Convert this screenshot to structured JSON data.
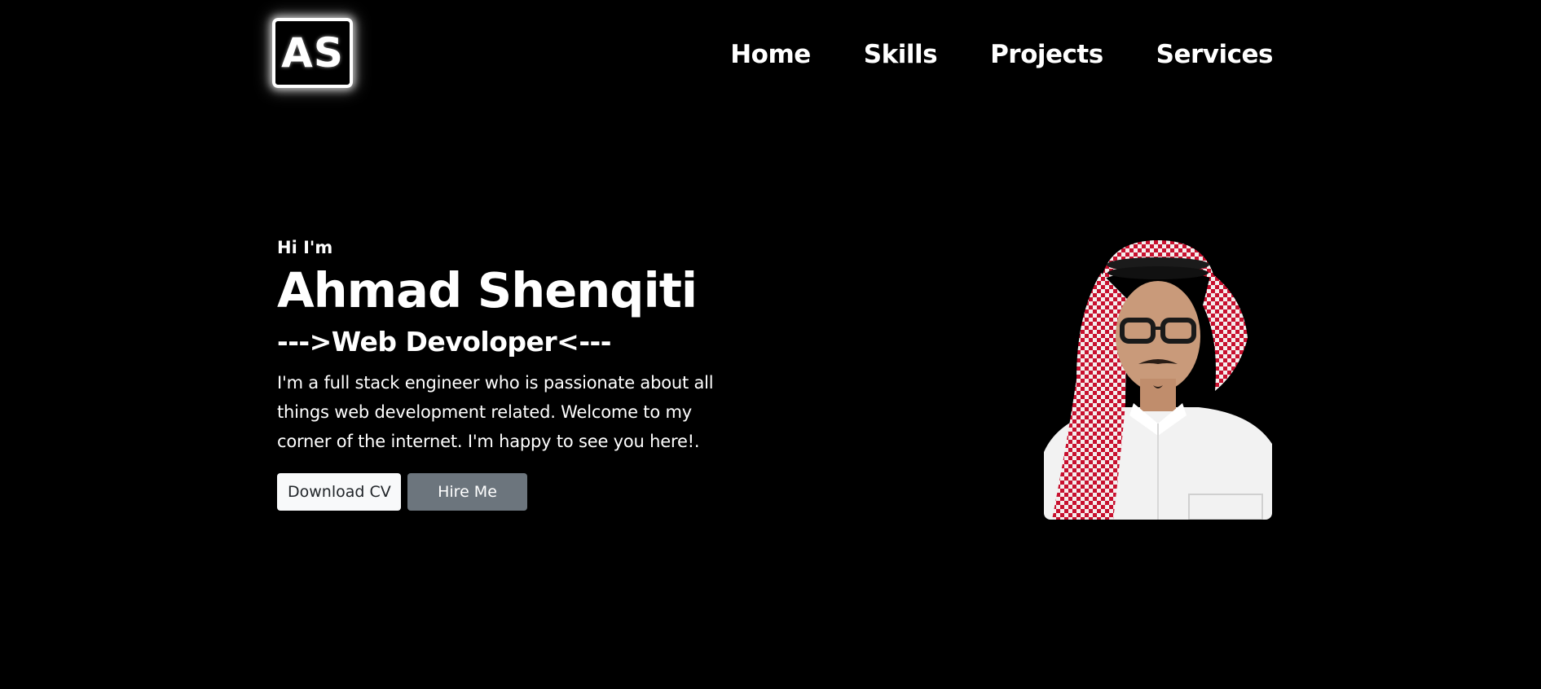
{
  "header": {
    "logo_text": "AS",
    "nav": [
      {
        "label": "Home"
      },
      {
        "label": "Skills"
      },
      {
        "label": "Projects"
      },
      {
        "label": "Services"
      }
    ]
  },
  "hero": {
    "greeting": "Hi I'm",
    "name": "Ahmad Shenqiti",
    "role": "--->Web Devoloper<---",
    "description": "I'm a full stack engineer who is passionate about all things web development related. Welcome to my corner of the internet. I'm happy to see you here!.",
    "buttons": {
      "download_cv": "Download CV",
      "hire_me": "Hire Me"
    }
  },
  "colors": {
    "background": "#000000",
    "text": "#ffffff",
    "button_light": "#f8f9fa",
    "button_secondary": "#6c757d",
    "shemagh_red": "#c8102e"
  }
}
